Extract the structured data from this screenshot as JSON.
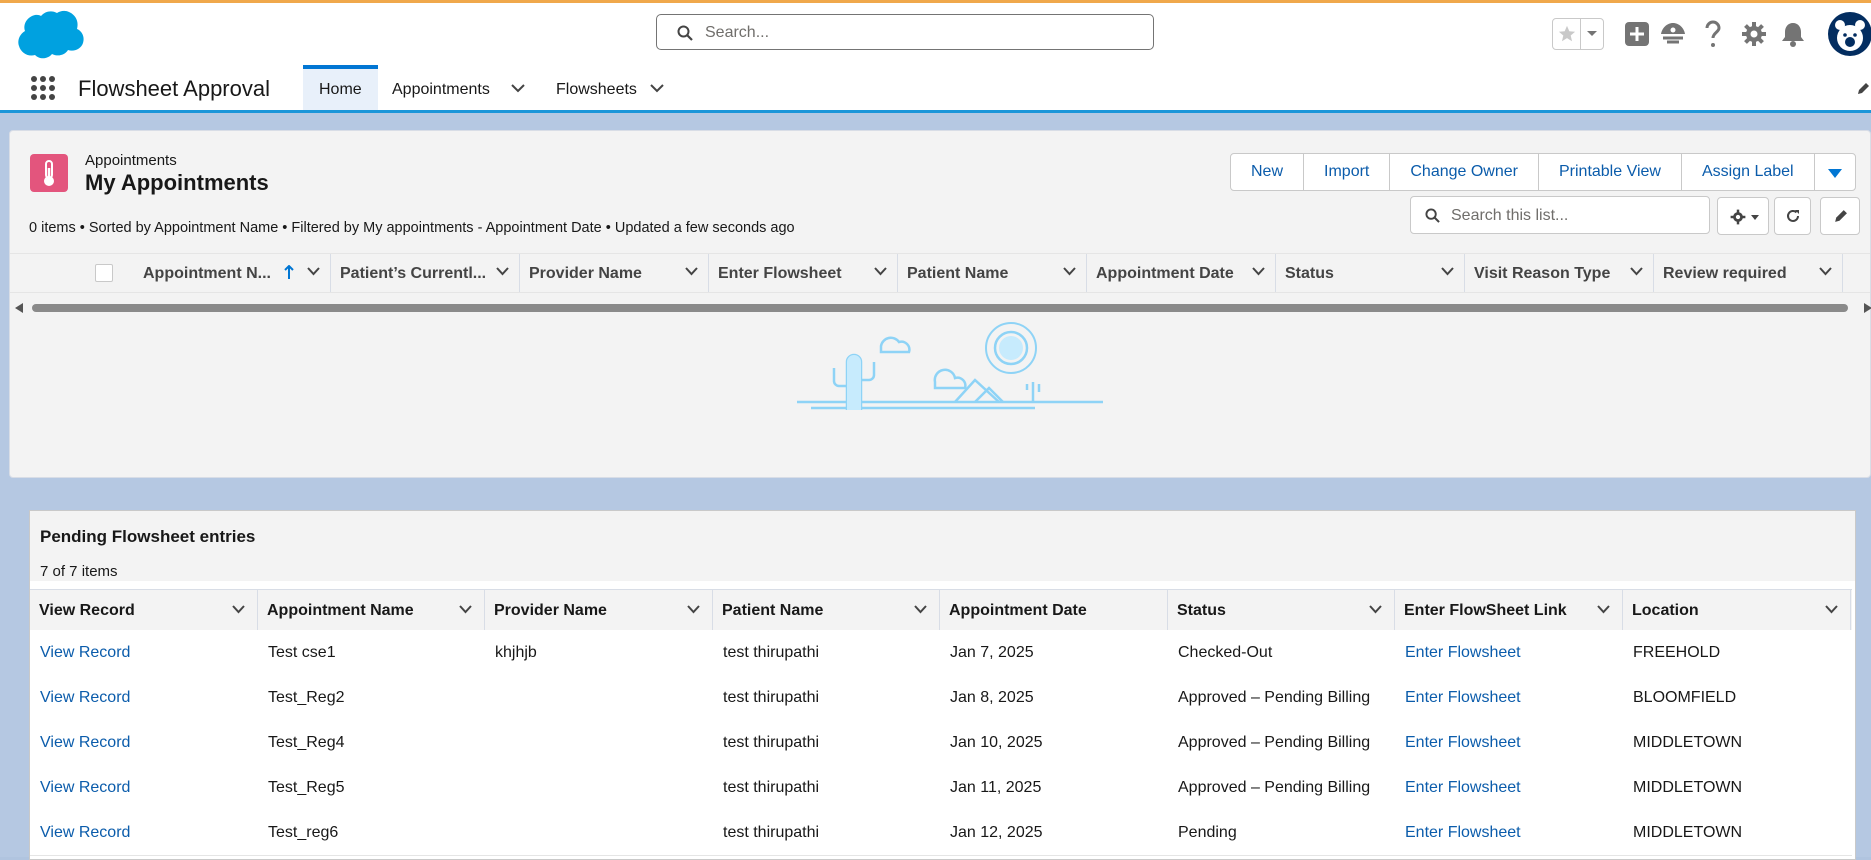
{
  "header": {
    "search_placeholder": "Search..."
  },
  "nav": {
    "app_name": "Flowsheet Approval",
    "tabs": [
      {
        "label": "Home"
      },
      {
        "label": "Appointments"
      },
      {
        "label": "Flowsheets"
      }
    ]
  },
  "list_view": {
    "object_label": "Appointments",
    "title": "My Appointments",
    "meta": "0 items • Sorted by Appointment Name • Filtered by My appointments - Appointment Date • Updated a few seconds ago",
    "buttons": [
      "New",
      "Import",
      "Change Owner",
      "Printable View",
      "Assign Label"
    ],
    "search_placeholder": "Search this list...",
    "columns": [
      "Appointment N...",
      "Patient’s Currentl...",
      "Provider Name",
      "Enter Flowsheet",
      "Patient Name",
      "Appointment Date",
      "Status",
      "Visit Reason Type",
      "Review required"
    ]
  },
  "pending": {
    "title": "Pending Flowsheet entries",
    "count": "7 of 7 items",
    "columns": [
      "View Record",
      "Appointment Name",
      "Provider Name",
      "Patient Name",
      "Appointment Date",
      "Status",
      "Enter FlowSheet Link",
      "Location"
    ],
    "rows": [
      {
        "view": "View Record",
        "appt": "Test cse1",
        "provider": "khjhjb",
        "patient": "test thirupathi",
        "date": "Jan 7, 2025",
        "status": "Checked-Out",
        "link": "Enter Flowsheet",
        "location": "FREEHOLD"
      },
      {
        "view": "View Record",
        "appt": "Test_Reg2",
        "provider": "",
        "patient": "test thirupathi",
        "date": "Jan 8, 2025",
        "status": "Approved – Pending Billing",
        "link": "Enter Flowsheet",
        "location": "BLOOMFIELD"
      },
      {
        "view": "View Record",
        "appt": "Test_Reg4",
        "provider": "",
        "patient": "test thirupathi",
        "date": "Jan 10, 2025",
        "status": "Approved – Pending Billing",
        "link": "Enter Flowsheet",
        "location": "MIDDLETOWN"
      },
      {
        "view": "View Record",
        "appt": "Test_Reg5",
        "provider": "",
        "patient": "test thirupathi",
        "date": "Jan 11, 2025",
        "status": "Approved – Pending Billing",
        "link": "Enter Flowsheet",
        "location": "MIDDLETOWN"
      },
      {
        "view": "View Record",
        "appt": "Test_reg6",
        "provider": "",
        "patient": "test thirupathi",
        "date": "Jan 12, 2025",
        "status": "Pending",
        "link": "Enter Flowsheet",
        "location": "MIDDLETOWN"
      }
    ]
  },
  "icons": {
    "cloud_logo": "salesforce-cloud-logo",
    "obj_icon": "thermometer-icon"
  },
  "colors": {
    "brand_blue": "#0176d3",
    "link_blue": "#0b5cab",
    "object_icon_pink": "#e3557d",
    "accent_orange": "#f0a84b"
  }
}
